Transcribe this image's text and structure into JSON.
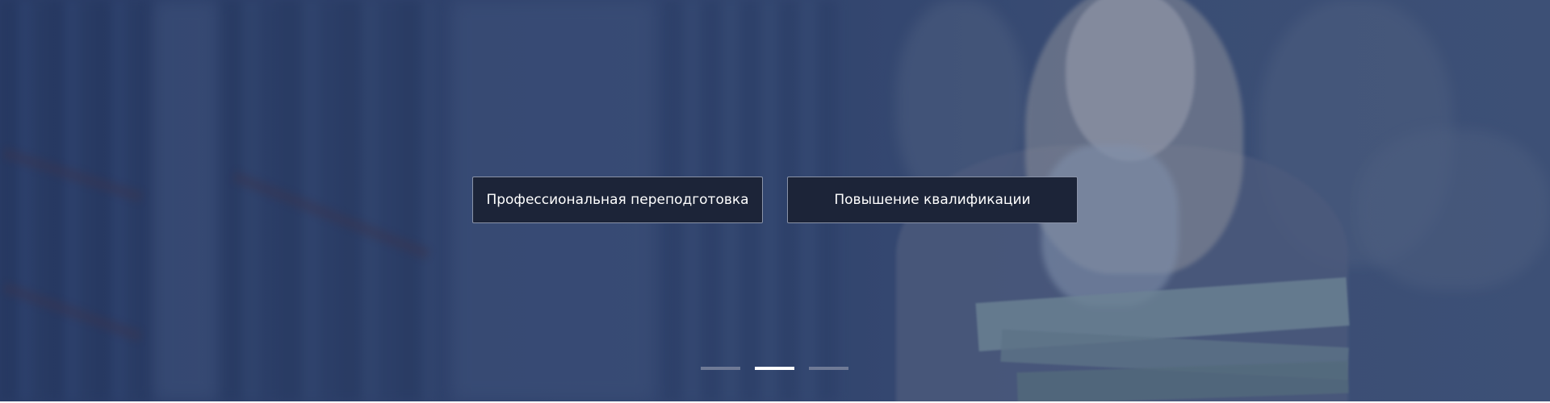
{
  "hero": {
    "buttons": [
      {
        "label": "Профессиональная переподготовка"
      },
      {
        "label": "Повышение квалификации"
      }
    ],
    "slider": {
      "slide_count": 3,
      "active_index": 1
    }
  },
  "colors": {
    "overlay": "#2f426c",
    "button_bg": "#1c2438",
    "button_border": "#8a93a8",
    "dot_inactive": "#6f7a96",
    "dot_active": "#ffffff"
  }
}
